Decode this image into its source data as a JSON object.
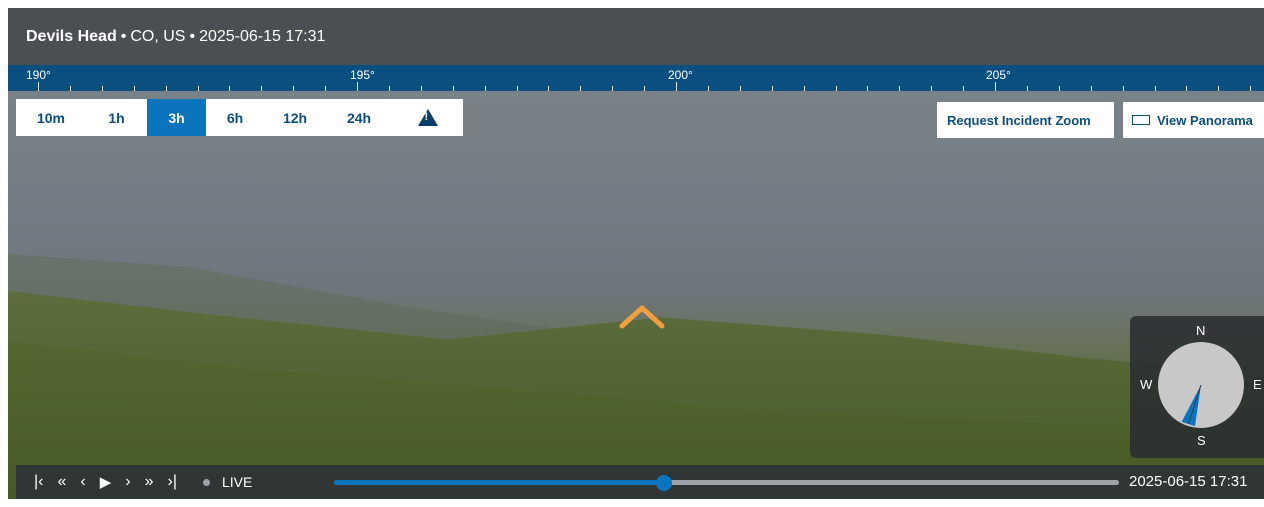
{
  "header": {
    "camera_name": "Devils Head",
    "separator": "•",
    "location": "CO, US",
    "timestamp": "2025-06-15 17:31"
  },
  "ruler": {
    "labels": [
      "190°",
      "195°",
      "200°",
      "205°"
    ],
    "colors": {
      "background": "#0a4f80",
      "ticks": "#dfe8ef"
    }
  },
  "time_range": {
    "options": [
      "10m",
      "1h",
      "3h",
      "6h",
      "12h",
      "24h"
    ],
    "selected": "3h",
    "alert_icon": "warning-triangle-icon"
  },
  "actions": {
    "request_zoom_label": "Request Incident Zoom",
    "view_panorama_label": "View Panorama",
    "panorama_icon": "panorama-frame-icon"
  },
  "compass": {
    "north": "N",
    "south": "S",
    "east": "E",
    "west": "W",
    "heading_deg": 198
  },
  "playback": {
    "first_icon": "skip-to-first-icon",
    "rewind_icon": "rewind-icon",
    "prev_icon": "step-back-icon",
    "play_icon": "play-icon",
    "next_icon": "step-forward-icon",
    "fast_forward_icon": "fast-forward-icon",
    "last_icon": "skip-to-last-icon",
    "live_label": "LIVE",
    "progress": 0.42,
    "current_time": "2025-06-15 17:31"
  },
  "colors": {
    "accent": "#0a74bf",
    "brand": "#0a4f80",
    "marker": "#f0a040"
  }
}
